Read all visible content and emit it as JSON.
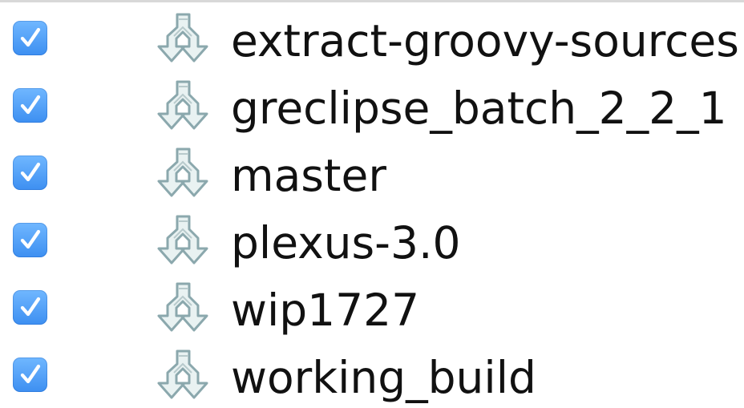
{
  "colors": {
    "checkbox": "#4da0f8",
    "icon": "#8ba8ad",
    "text": "#111111"
  },
  "branches": [
    {
      "label": "extract-groovy-sources",
      "checked": true,
      "icon": "branch-icon"
    },
    {
      "label": "greclipse_batch_2_2_1",
      "checked": true,
      "icon": "branch-icon"
    },
    {
      "label": "master",
      "checked": true,
      "icon": "branch-icon"
    },
    {
      "label": "plexus-3.0",
      "checked": true,
      "icon": "branch-icon"
    },
    {
      "label": "wip1727",
      "checked": true,
      "icon": "branch-icon"
    },
    {
      "label": "working_build",
      "checked": true,
      "icon": "branch-icon"
    }
  ]
}
